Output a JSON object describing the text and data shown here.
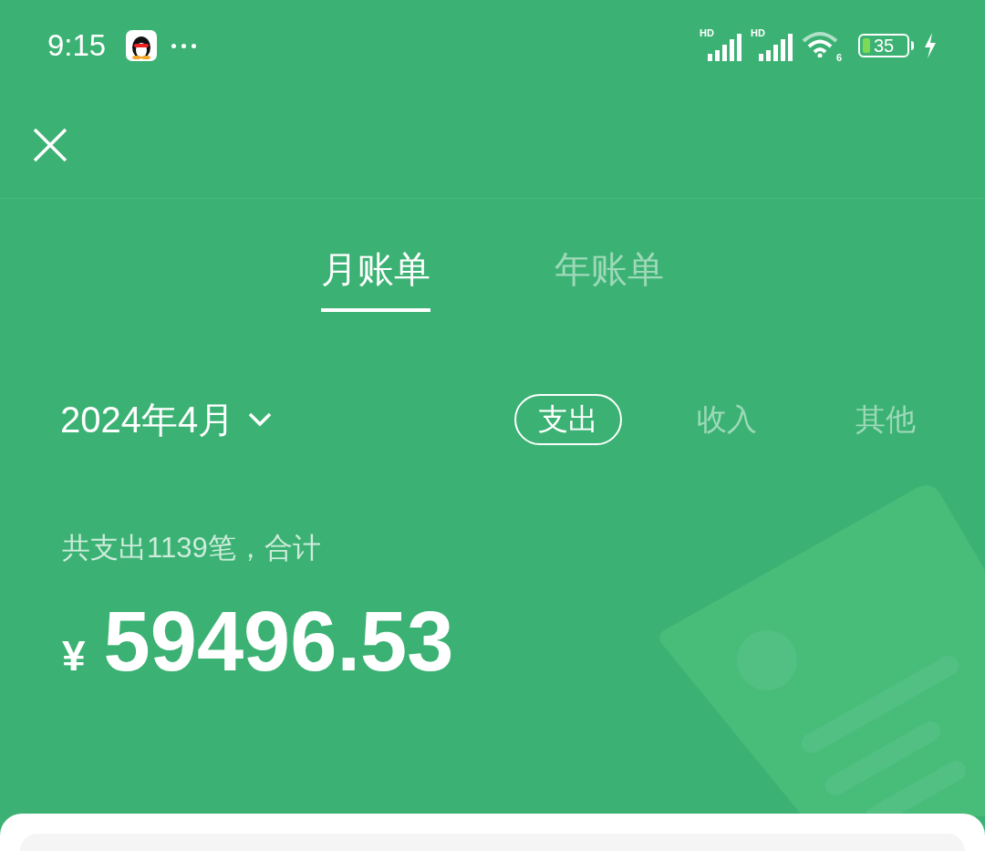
{
  "status_bar": {
    "time": "9:15",
    "signals": [
      {
        "label": "HD"
      },
      {
        "label": "HD"
      }
    ],
    "wifi_label": "6",
    "battery": "35"
  },
  "tabs": [
    {
      "label": "月账单",
      "selected": true
    },
    {
      "label": "年账单",
      "selected": false
    }
  ],
  "period": "2024年4月",
  "types": [
    {
      "label": "支出",
      "selected": true
    },
    {
      "label": "收入",
      "selected": false
    },
    {
      "label": "其他",
      "selected": false
    }
  ],
  "summary": "共支出1139笔，合计",
  "currency": "¥",
  "amount": "59496.53"
}
